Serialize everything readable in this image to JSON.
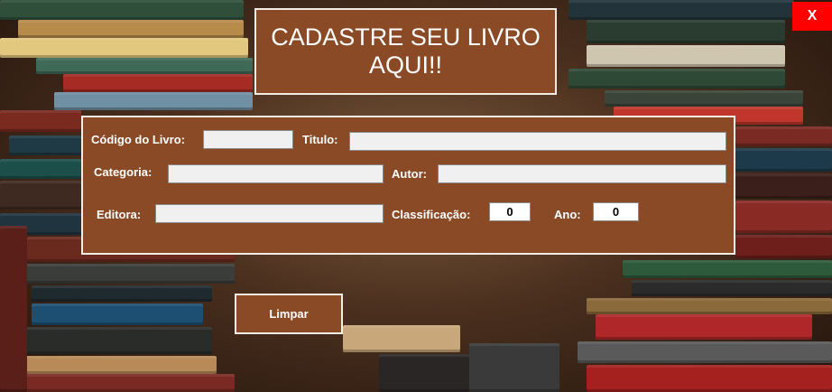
{
  "window": {
    "title": "CADASTRE SEU LIVRO AQUI!!",
    "close_label": "X"
  },
  "form": {
    "codigo_label": "Código do Livro:",
    "codigo_value": "",
    "titulo_label": "Titulo:",
    "titulo_value": "",
    "categoria_label": "Categoria:",
    "categoria_value": "",
    "autor_label": "Autor:",
    "autor_value": "",
    "editora_label": "Editora:",
    "editora_value": "",
    "classificacao_label": "Classificação:",
    "classificacao_value": "0",
    "ano_label": "Ano:",
    "ano_value": "0"
  },
  "actions": {
    "clear_label": "Limpar"
  },
  "colors": {
    "panel": "#8b4a26",
    "border": "#f3ece6",
    "close": "#ff0000"
  }
}
